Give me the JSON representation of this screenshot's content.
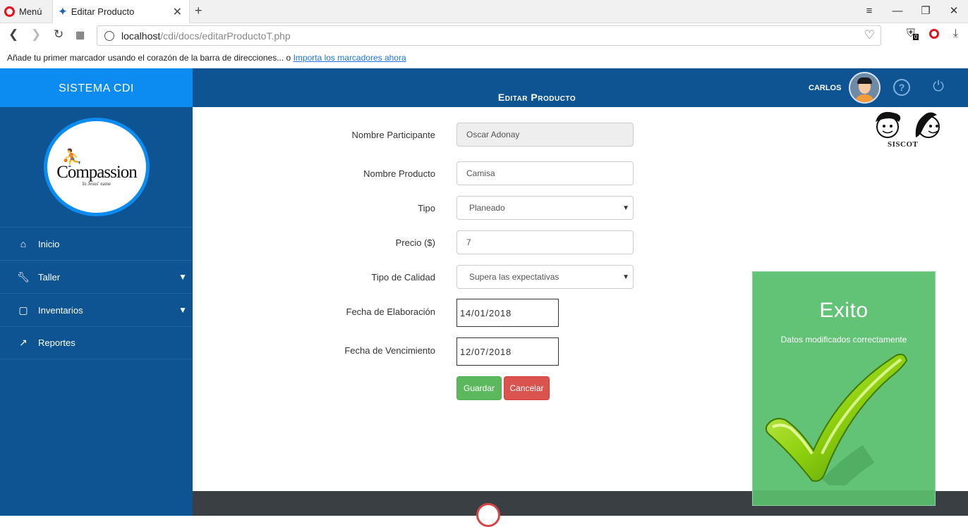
{
  "browser": {
    "menu_label": "Menú",
    "tab_title": "Editar Producto",
    "url_host": "localhost",
    "url_path": "/cdi/docs/editarProductoT.php",
    "bookmarks_text": "Añade tu primer marcador usando el corazón de la barra de direcciones... o",
    "bookmarks_link": "Importa los marcadores ahora",
    "badge_count": "0"
  },
  "sidebar": {
    "brand": "SISTEMA CDI",
    "logo_text": "Compassion",
    "logo_tagline": "In Jesus' name",
    "items": [
      {
        "label": "Inicio",
        "icon": "home-icon",
        "has_submenu": false
      },
      {
        "label": "Taller",
        "icon": "wrench-icon",
        "has_submenu": true
      },
      {
        "label": "Inventarios",
        "icon": "clipboard-icon",
        "has_submenu": true
      },
      {
        "label": "Reportes",
        "icon": "trending-icon",
        "has_submenu": false
      }
    ]
  },
  "header": {
    "title": "Editar Producto",
    "user": "CARLOS",
    "siscot": "SISCOT"
  },
  "form": {
    "participant_label": "Nombre Participante",
    "participant_value": "Oscar Adonay",
    "product_label": "Nombre Producto",
    "product_value": "Camisa",
    "type_label": "Tipo",
    "type_value": "Planeado",
    "price_label": "Precio ($)",
    "price_value": "7",
    "quality_label": "Tipo de Calidad",
    "quality_value": "Supera las expectativas",
    "made_label": "Fecha de Elaboración",
    "made_value": "14/01/2018",
    "expiry_label": "Fecha de Vencimiento",
    "expiry_value": "12/07/2018",
    "save_label": "Guardar",
    "cancel_label": "Cancelar"
  },
  "toast": {
    "title": "Exito",
    "message": "Datos modificados correctamente",
    "background": "#62c275"
  },
  "colors": {
    "sidebar": "#0e5493",
    "brand": "#0c8cf0",
    "save": "#5cb85c",
    "cancel": "#d9534f"
  }
}
